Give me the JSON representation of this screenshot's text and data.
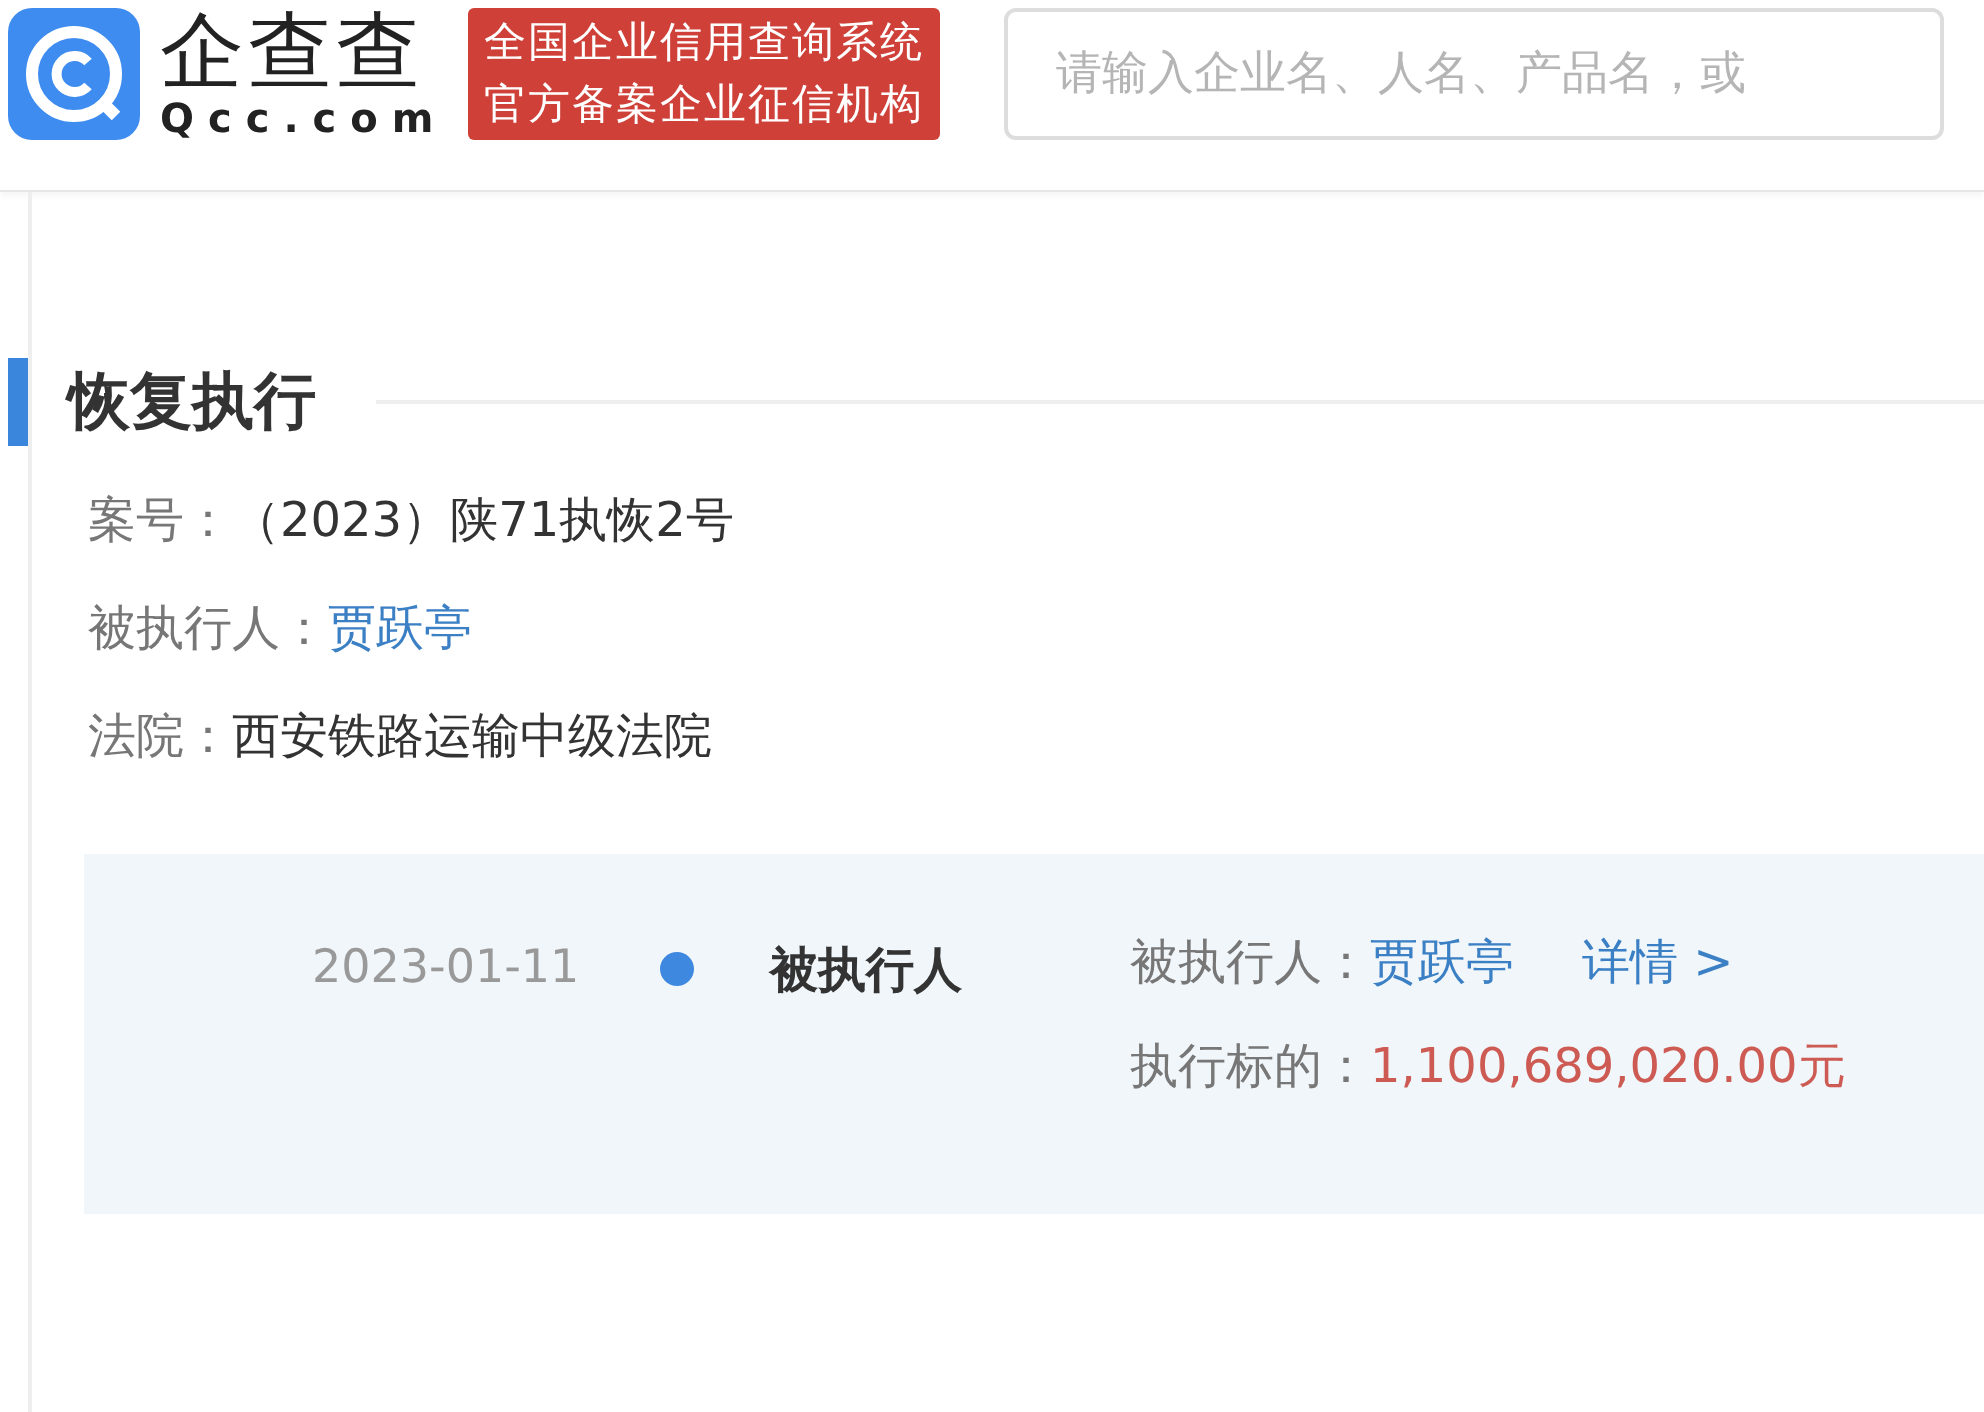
{
  "header": {
    "brand": "企查查",
    "domain": "Qcc.com",
    "badge_lines": [
      "全国企业信用查询系统",
      "官方备案企业征信机构"
    ],
    "search": {
      "placeholder": "请输入企业名、人名、产品名，或"
    }
  },
  "section": {
    "title": "恢复执行",
    "fields": [
      {
        "label": "案号：",
        "value": "（2023）陕71执恢2号",
        "kind": "text"
      },
      {
        "label": "被执行人：",
        "value": "贾跃亭",
        "kind": "link"
      },
      {
        "label": "法院：",
        "value": "西安铁路运输中级法院",
        "kind": "text"
      }
    ]
  },
  "timeline": [
    {
      "date": "2023-01-11",
      "color": "#3f88e0",
      "role": "被执行人",
      "more": "详情 >",
      "details": [
        {
          "label": "被执行人：",
          "value": "贾跃亭",
          "kind": "link"
        },
        {
          "label": "执行标的：",
          "value": "1,100,689,020.00元",
          "kind": "amount"
        }
      ]
    }
  ]
}
